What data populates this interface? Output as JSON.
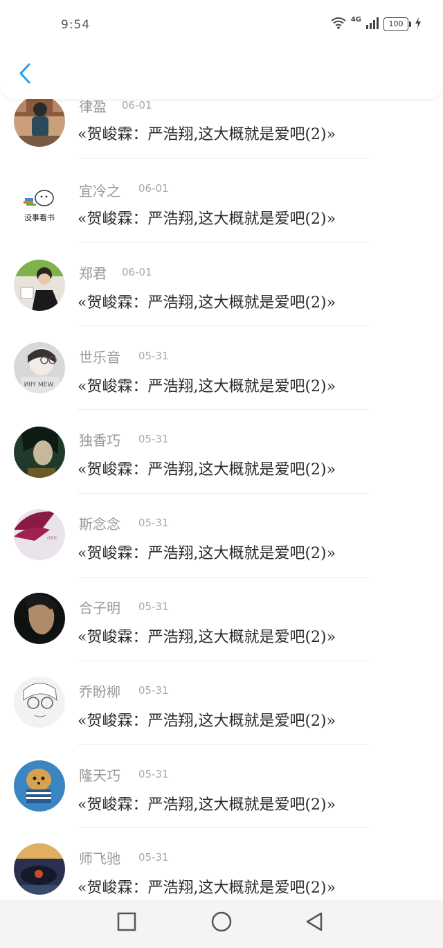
{
  "status_bar": {
    "time": "9:54",
    "network": "4G",
    "battery": "100"
  },
  "header": {
    "back_icon": "chevron-left-icon",
    "accent_color": "#2a9de6"
  },
  "list": {
    "items": [
      {
        "name": "律盈",
        "date": "06-01",
        "title": "«贺峻霖：严浩翔,这大概就是爱吧(2)»",
        "avatar_colors": [
          "#8c5a3c",
          "#2b4a5c"
        ]
      },
      {
        "name": "宜冷之",
        "date": "06-01",
        "title": "«贺峻霖：严浩翔,这大概就是爱吧(2)»",
        "avatar_label": "没事看书",
        "avatar_colors": [
          "#ffffff",
          "#333333"
        ]
      },
      {
        "name": "郑君",
        "date": "06-01",
        "title": "«贺峻霖：严浩翔,这大概就是爱吧(2)»",
        "avatar_colors": [
          "#7fb24a",
          "#1a1a1a"
        ]
      },
      {
        "name": "世乐音",
        "date": "05-31",
        "title": "«贺峻霖：严浩翔,这大概就是爱吧(2)»",
        "avatar_colors": [
          "#d8d8d8",
          "#555555"
        ]
      },
      {
        "name": "独香巧",
        "date": "05-31",
        "title": "«贺峻霖：严浩翔,这大概就是爱吧(2)»",
        "avatar_colors": [
          "#1f3a2a",
          "#c8b89a"
        ]
      },
      {
        "name": "斯念念",
        "date": "05-31",
        "title": "«贺峻霖：严浩翔,这大概就是爱吧(2)»",
        "avatar_colors": [
          "#8a1a44",
          "#e9e3ea"
        ]
      },
      {
        "name": "合子明",
        "date": "05-31",
        "title": "«贺峻霖：严浩翔,这大概就是爱吧(2)»",
        "avatar_colors": [
          "#0e1210",
          "#b08b6a"
        ]
      },
      {
        "name": "乔盼柳",
        "date": "05-31",
        "title": "«贺峻霖：严浩翔,这大概就是爱吧(2)»",
        "avatar_colors": [
          "#f2f2f2",
          "#6a6a7a"
        ]
      },
      {
        "name": "隆天巧",
        "date": "05-31",
        "title": "«贺峻霖：严浩翔,这大概就是爱吧(2)»",
        "avatar_colors": [
          "#3a86c2",
          "#d9a050"
        ]
      },
      {
        "name": "师飞驰",
        "date": "05-31",
        "title": "«贺峻霖：严浩翔,这大概就是爱吧(2)»",
        "avatar_colors": [
          "#2a3050",
          "#c84a2a"
        ]
      }
    ]
  },
  "nav_bar": {
    "recents_icon": "square-icon",
    "home_icon": "circle-icon",
    "back_icon": "triangle-back-icon"
  }
}
